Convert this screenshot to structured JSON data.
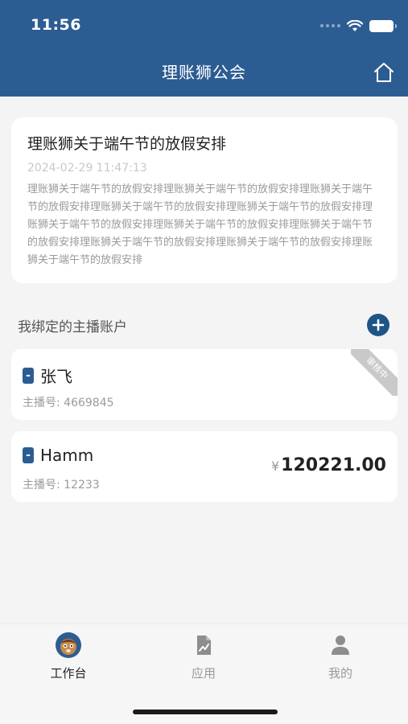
{
  "status_bar": {
    "time": "11:56"
  },
  "header": {
    "title": "理账狮公会"
  },
  "notice": {
    "title": "理账狮关于端午节的放假安排",
    "time": "2024-02-29 11:47:13",
    "body": "理账狮关于端午节的放假安排理账狮关于端午节的放假安排理账狮关于端午节的放假安排理账狮关于端午节的放假安排理账狮关于端午节的放假安排理账狮关于端午节的放假安排理账狮关于端午节的放假安排理账狮关于端午节的放假安排理账狮关于端午节的放假安排理账狮关于端午节的放假安排理账狮关于端午节的放假安排"
  },
  "section": {
    "title": "我绑定的主播账户"
  },
  "accounts": [
    {
      "name": "张飞",
      "id_label": "主播号: 4669845",
      "ribbon": "审核中"
    },
    {
      "name": "Hamm",
      "id_label": "主播号: 12233",
      "currency": "¥",
      "amount": "120221.00"
    }
  ],
  "tabbar": {
    "items": [
      {
        "label": "工作台",
        "icon": "mascot-avatar-icon",
        "active": true
      },
      {
        "label": "应用",
        "icon": "chart-file-icon",
        "active": false
      },
      {
        "label": "我的",
        "icon": "user-icon",
        "active": false
      }
    ]
  },
  "colors": {
    "brand": "#2c5d92",
    "background": "#f4f4f4",
    "card": "#ffffff"
  }
}
